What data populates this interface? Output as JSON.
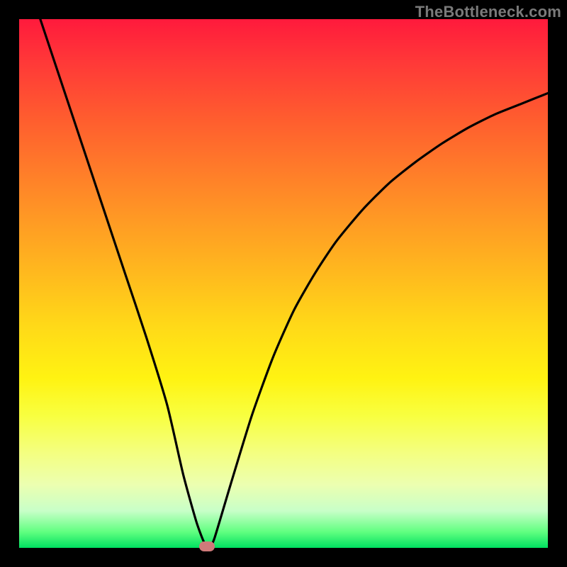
{
  "watermark": "TheBottleneck.com",
  "chart_data": {
    "type": "line",
    "title": "",
    "xlabel": "",
    "ylabel": "",
    "x_range": [
      0,
      100
    ],
    "y_range": [
      0,
      100
    ],
    "series": [
      {
        "name": "bottleneck-curve",
        "x": [
          4,
          8,
          12,
          16,
          20,
          24,
          28,
          31,
          33.5,
          35,
          36,
          37,
          40,
          44,
          48,
          52,
          56,
          60,
          65,
          70,
          75,
          80,
          85,
          90,
          95,
          100
        ],
        "y": [
          100,
          88,
          76,
          64,
          52,
          40,
          27,
          14,
          5,
          1,
          0,
          2,
          12,
          25,
          36,
          45,
          52,
          58,
          64,
          69,
          73,
          76.5,
          79.5,
          82,
          84,
          86
        ]
      }
    ],
    "marker": {
      "x": 35.5,
      "y": 0
    },
    "colors": {
      "curve": "#000000",
      "marker": "#cf7a7a",
      "gradient_top": "#ff1a3c",
      "gradient_bottom": "#00e060",
      "frame": "#000000"
    }
  }
}
